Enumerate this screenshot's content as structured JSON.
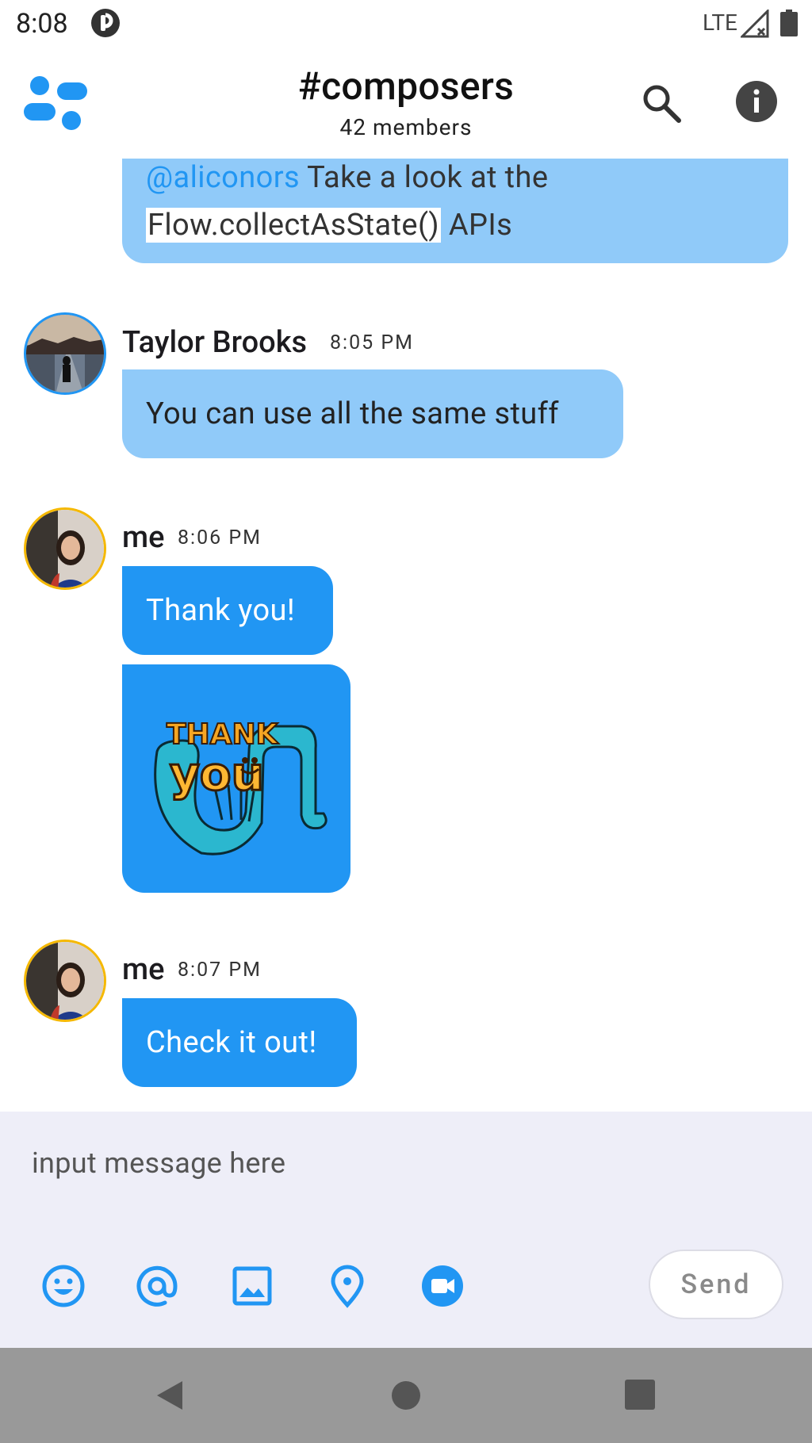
{
  "status_bar": {
    "time": "8:08",
    "network": "LTE"
  },
  "header": {
    "channel_name": "#composers",
    "member_count": "42 members"
  },
  "messages": {
    "partial": {
      "mention": "@aliconors",
      "text_before": " Take a look at the",
      "code": "Flow.collectAsState()",
      "text_after": " APIs"
    },
    "taylor": {
      "author": "Taylor Brooks",
      "time": "8:05 PM",
      "text": "You can use all the same stuff"
    },
    "me1": {
      "author": "me",
      "time": "8:06 PM",
      "text": "Thank you!"
    },
    "sticker": {
      "text_top": "THANK",
      "text_bottom": "you"
    },
    "me2": {
      "author": "me",
      "time": "8:07 PM",
      "text": "Check it out!"
    }
  },
  "composer": {
    "placeholder": "input message here",
    "send_label": "Send",
    "tools": [
      "emoji-icon",
      "mention-icon",
      "image-icon",
      "location-icon",
      "video-call-icon"
    ]
  },
  "colors": {
    "accent": "#2196f3",
    "bubble_light": "#90caf9",
    "composer_bg": "#eeeef8",
    "nav_bar": "#999999",
    "avatar_ring_me": "#f5b800"
  }
}
